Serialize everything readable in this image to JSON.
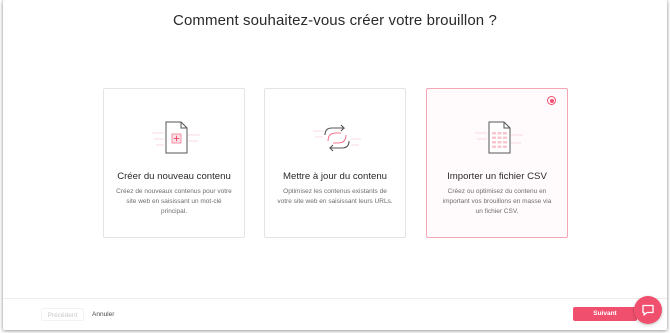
{
  "page": {
    "title": "Comment souhaitez-vous créer votre brouillon ?"
  },
  "cards": [
    {
      "title": "Créer du nouveau contenu",
      "description": "Créez de nouveaux contenus pour votre site web en saisissant un mot-clé principal.",
      "icon": "new-document-icon",
      "selected": false
    },
    {
      "title": "Mettre à jour du contenu",
      "description": "Optimisez les contenus existants de votre site web en saisissant leurs URLs.",
      "icon": "refresh-arrows-icon",
      "selected": false
    },
    {
      "title": "Importer un fichier CSV",
      "description": "Créez ou optimisez du contenu en important vos brouillons en masse via un fichier CSV.",
      "icon": "csv-file-icon",
      "selected": true
    }
  ],
  "footer": {
    "previous_label": "Précédent",
    "cancel_label": "Annuler",
    "next_label": "Suivant"
  },
  "chat": {
    "icon": "chat-bubble-icon"
  },
  "colors": {
    "accent": "#f0506e",
    "selected_border": "#f5a5b4"
  }
}
